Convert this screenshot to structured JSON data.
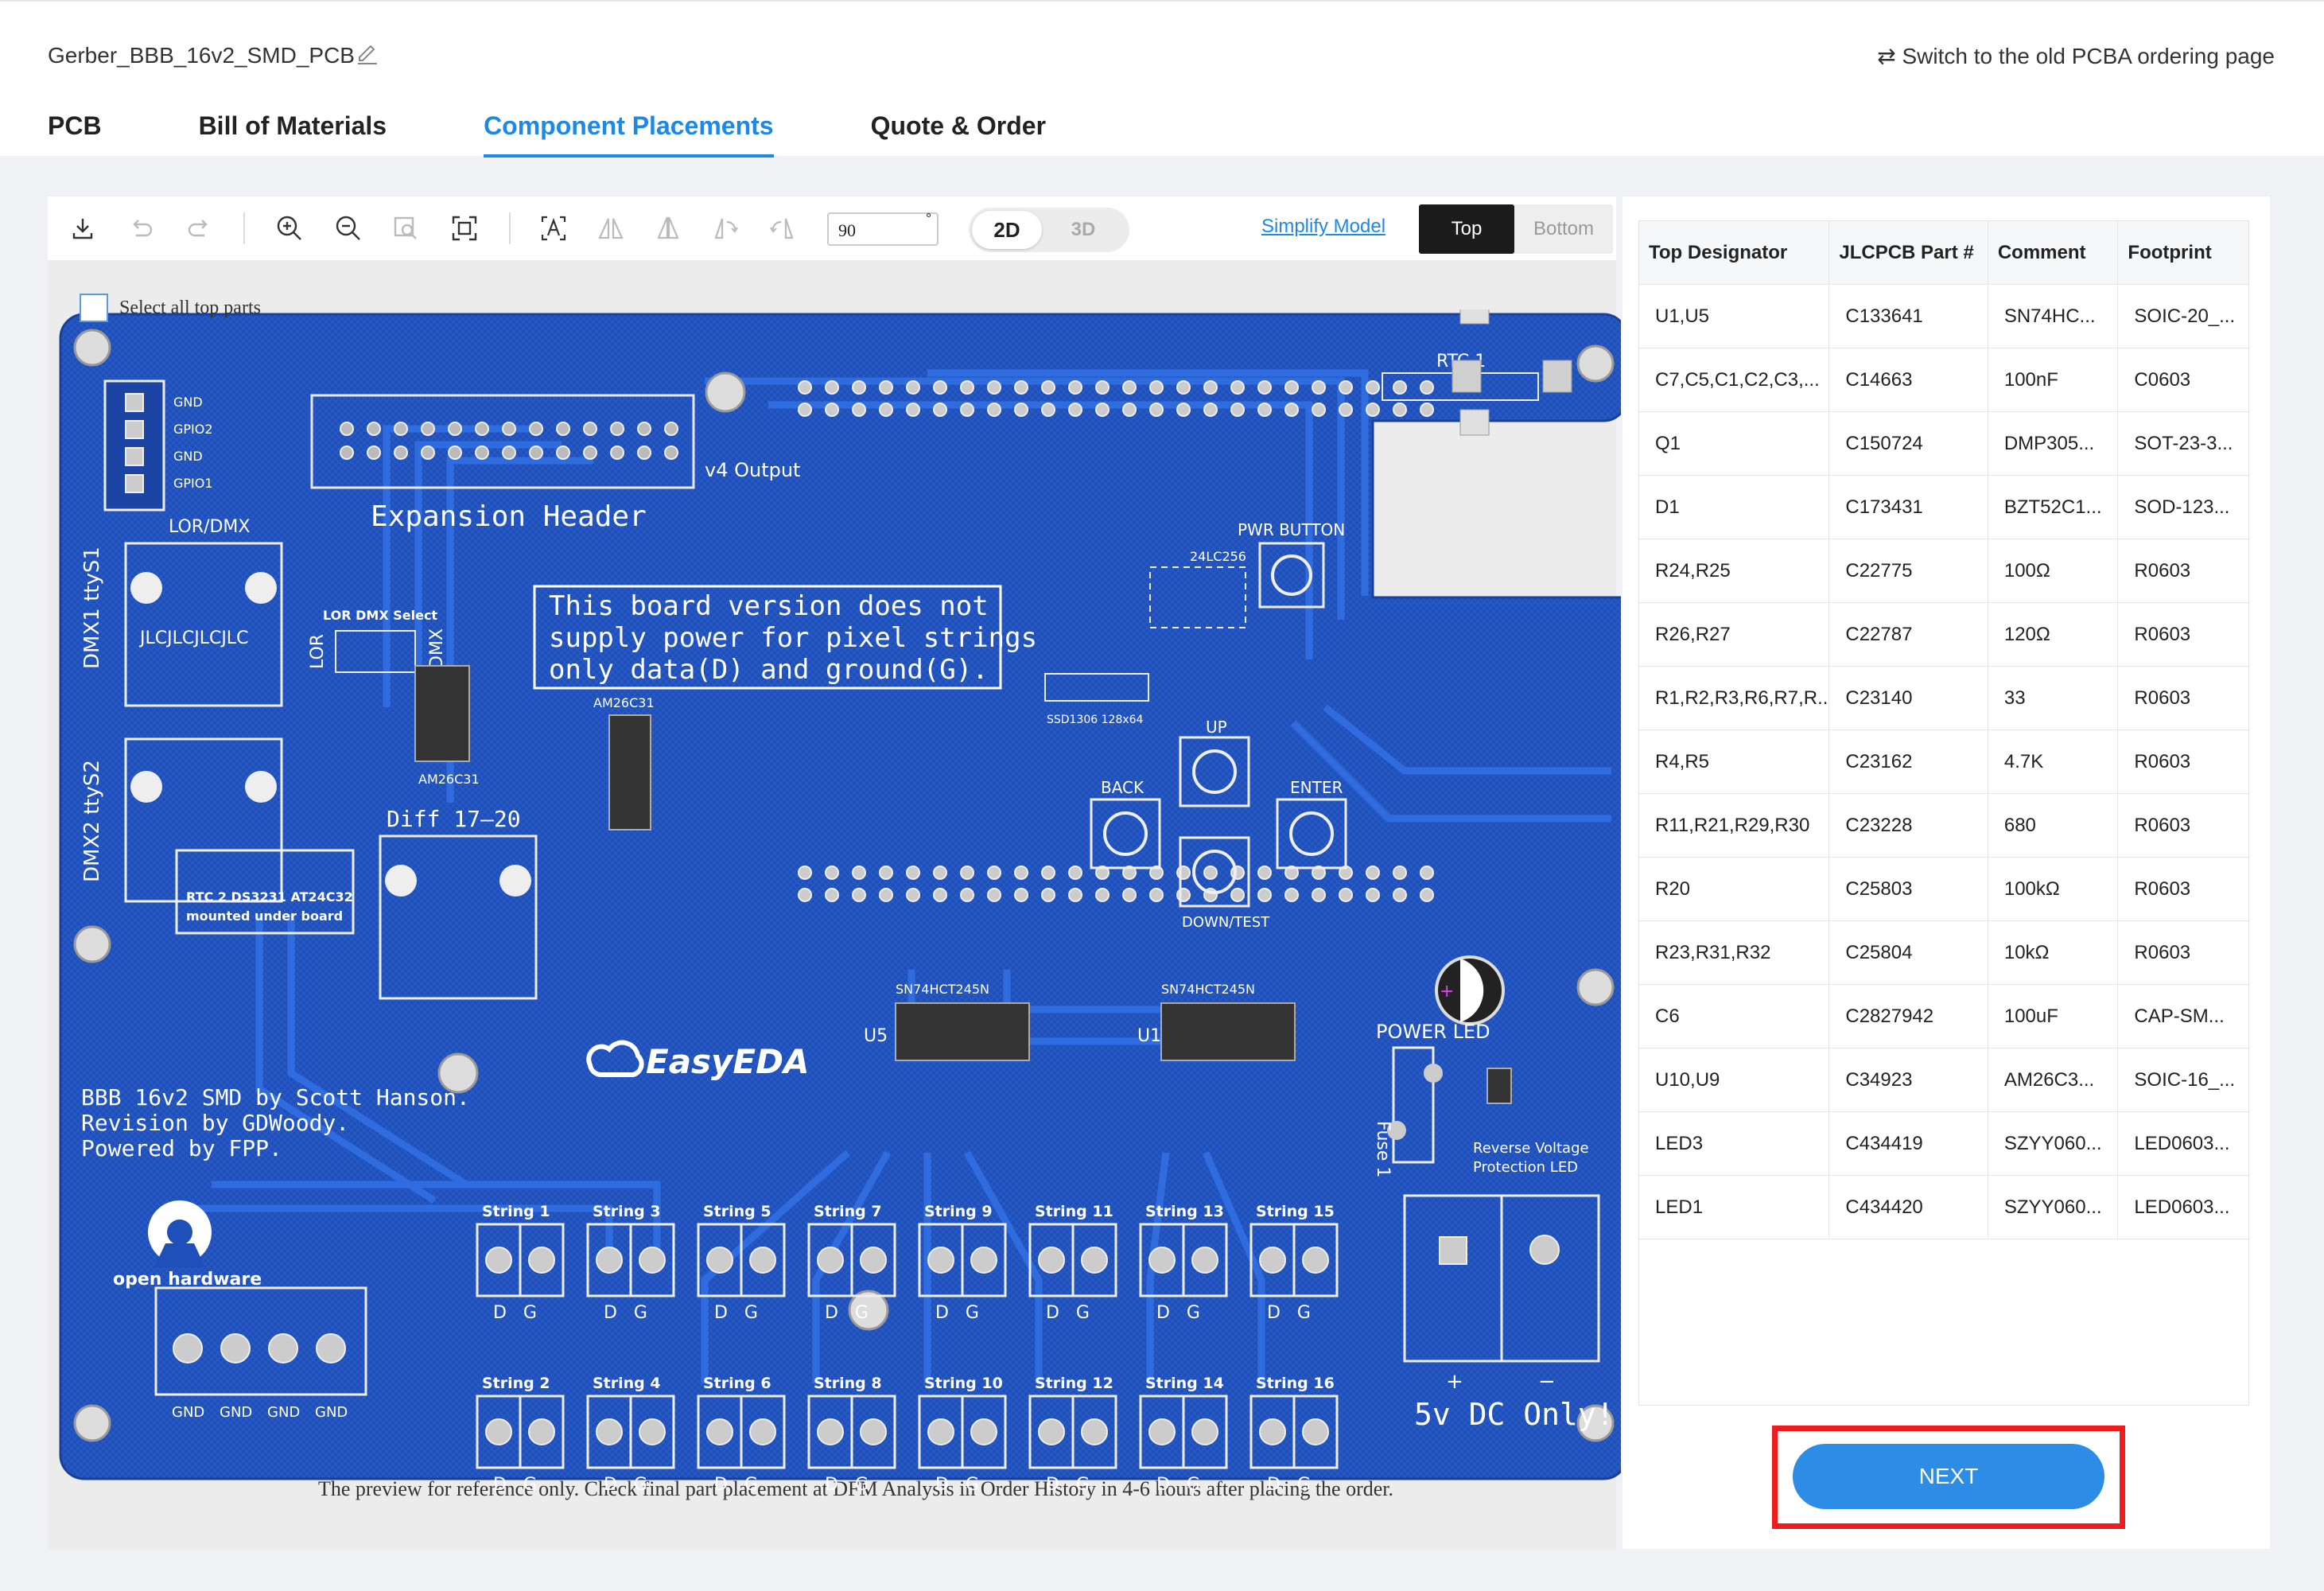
{
  "header": {
    "file_name": "Gerber_BBB_16v2_SMD_PCB",
    "switch_link": "⇄ Switch to the old PCBA ordering page",
    "tabs": [
      "PCB",
      "Bill of Materials",
      "Component Placements",
      "Quote & Order"
    ],
    "active_tab": "Component Placements"
  },
  "toolbar": {
    "rotation_value": "90",
    "rotation_unit": "°",
    "view_2d": "2D",
    "view_3d": "3D",
    "simplify_model": "Simplify Model",
    "side_top": "Top",
    "side_bottom": "Bottom",
    "icons": [
      "download-icon",
      "undo-icon",
      "redo-icon",
      "zoom-in-icon",
      "zoom-out-icon",
      "zoom-area-icon",
      "fit-view-icon",
      "select-text-icon",
      "flip-horizontal-icon",
      "flip-vertical-icon",
      "rotate-left-icon",
      "rotate-right-icon"
    ]
  },
  "canvas": {
    "select_all_label": "Select all top parts",
    "preview_note": "The preview for reference only. Check final part placement at DFM Analysis in Order History in 4-6 hours after placing the order."
  },
  "board": {
    "title": "Expansion Header",
    "output_label": "v4 Output",
    "notice": [
      "This board version does not",
      "supply power for pixel strings",
      "only data(D) and ground(G)."
    ],
    "credits": [
      "BBB 16v2 SMD by Scott Hanson.",
      "Revision by GDWoody.",
      "Powered by FPP."
    ],
    "brand": "EasyEDA",
    "open_hardware": "open hardware",
    "power_note": "5v DC Only!",
    "labels": {
      "lor_dmx": "LOR/DMX",
      "dmx1": "DMX1 ttyS1",
      "dmx2": "DMX2 ttyS2",
      "jlc": "JLCJLCJLCJLC",
      "lor_dmx_select": "LOR DMX Select",
      "lor": "LOR",
      "dmx": "DMX",
      "diff": "Diff 17–20",
      "rtc1": "RTC 1",
      "rtc2": "RTC 2 DS3231 AT24C32",
      "rtc2b": "mounted under board",
      "pwr_button": "PWR BUTTON",
      "up": "UP",
      "back": "BACK",
      "enter": "ENTER",
      "down": "DOWN/TEST",
      "power_led": "POWER LED",
      "fuse": "Fuse 1",
      "reverse": "Reverse Voltage",
      "protection": "Protection LED",
      "u5": "U5",
      "u1": "U1",
      "sn1": "SN74HCT245N",
      "sn2": "SN74HCT245N",
      "am1": "AM26C31",
      "am2": "AM26C31",
      "oled": "SSD1306 128x64",
      "eeprom": "24LC256",
      "plus": "+",
      "minus": "−"
    },
    "gpio_labels": [
      "GND",
      "GPIO2",
      "GND",
      "GPIO1"
    ],
    "gnd_labels": [
      "GND",
      "GND",
      "GND",
      "GND"
    ],
    "strings_top": [
      "String 1",
      "String 3",
      "String 5",
      "String 7",
      "String 9",
      "String 11",
      "String 13",
      "String 15"
    ],
    "strings_bottom": [
      "String 2",
      "String 4",
      "String 6",
      "String 8",
      "String 10",
      "String 12",
      "String 14",
      "String 16"
    ],
    "dg": "D   G"
  },
  "parts_table": {
    "headers": [
      "Top Designator",
      "JLCPCB Part #",
      "Comment",
      "Footprint"
    ],
    "rows": [
      [
        "U1,U5",
        "C133641",
        "SN74HC...",
        "SOIC-20_..."
      ],
      [
        "C7,C5,C1,C2,C3,...",
        "C14663",
        "100nF",
        "C0603"
      ],
      [
        "Q1",
        "C150724",
        "DMP305...",
        "SOT-23-3..."
      ],
      [
        "D1",
        "C173431",
        "BZT52C1...",
        "SOD-123..."
      ],
      [
        "R24,R25",
        "C22775",
        "100Ω",
        "R0603"
      ],
      [
        "R26,R27",
        "C22787",
        "120Ω",
        "R0603"
      ],
      [
        "R1,R2,R3,R6,R7,R...",
        "C23140",
        "33",
        "R0603"
      ],
      [
        "R4,R5",
        "C23162",
        "4.7K",
        "R0603"
      ],
      [
        "R11,R21,R29,R30",
        "C23228",
        "680",
        "R0603"
      ],
      [
        "R20",
        "C25803",
        "100kΩ",
        "R0603"
      ],
      [
        "R23,R31,R32",
        "C25804",
        "10kΩ",
        "R0603"
      ],
      [
        "C6",
        "C2827942",
        "100uF",
        "CAP-SM..."
      ],
      [
        "U10,U9",
        "C34923",
        "AM26C3...",
        "SOIC-16_..."
      ],
      [
        "LED3",
        "C434419",
        "SZYY060...",
        "LED0603..."
      ],
      [
        "LED1",
        "C434420",
        "SZYY060...",
        "LED0603..."
      ]
    ]
  },
  "next_button": "NEXT",
  "colors": {
    "accent": "#1e88e5",
    "board": "#1f4fb8",
    "board_dark": "#173f9c",
    "trace": "#2c67d8",
    "highlight": "#ee1c1c"
  }
}
